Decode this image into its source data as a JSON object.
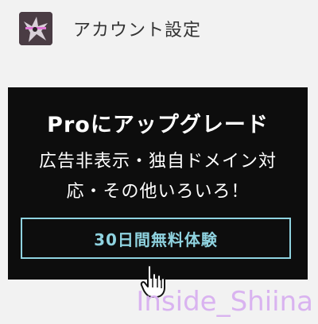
{
  "account": {
    "label": "アカウント設定",
    "avatar_icon": "user-avatar-icon"
  },
  "promo": {
    "title": "Proにアップグレード",
    "description_line1": "広告非表示・独自ドメイン対",
    "description_line2": "応・その他いろいろ！",
    "trial_button_label": "30日間無料体験",
    "background_color": "#0d0d0d",
    "accent_color": "#8fd3e0"
  },
  "cursor_icon": "hand-pointer-icon",
  "watermark": "Inside_Shiina"
}
